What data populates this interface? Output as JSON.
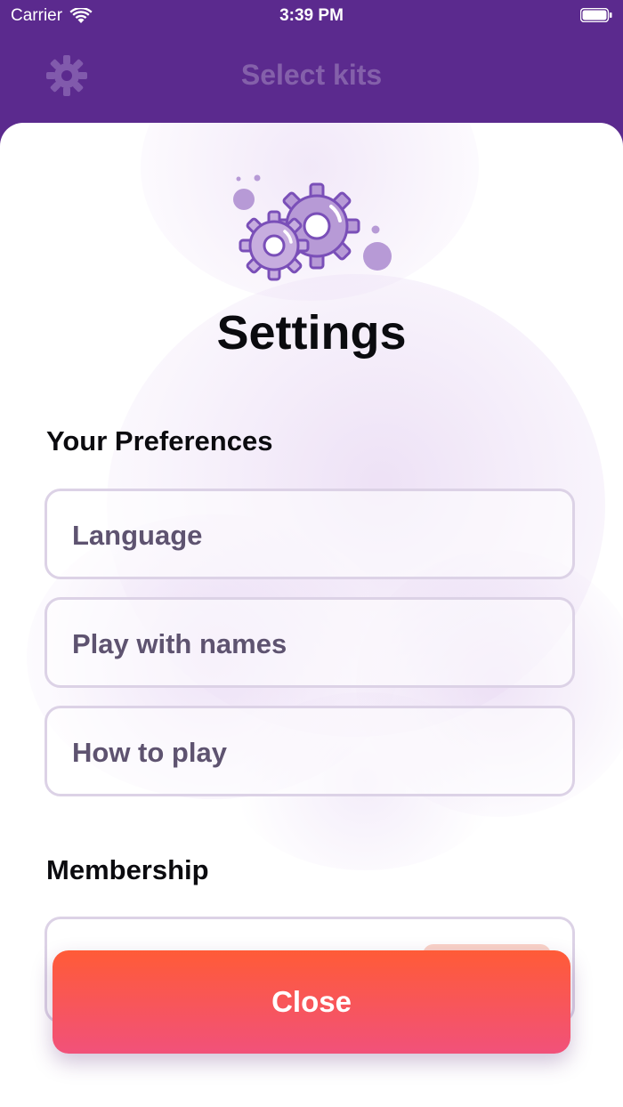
{
  "status_bar": {
    "carrier": "Carrier",
    "time": "3:39 PM"
  },
  "nav": {
    "title": "Select kits",
    "settings_icon": "gear-icon"
  },
  "sheet": {
    "icon": "gears-icon",
    "title": "Settings",
    "preferences": {
      "heading": "Your Preferences",
      "items": [
        {
          "label": "Language"
        },
        {
          "label": "Play with names"
        },
        {
          "label": "How to play"
        }
      ]
    },
    "membership": {
      "heading": "Membership"
    },
    "close_label": "Close"
  },
  "colors": {
    "nav_bg": "#5b2a8e",
    "accent_top": "#ff5b37",
    "accent_bottom": "#f1517a",
    "row_border": "#dcd2e6",
    "row_text": "#5e5370",
    "gear_fill": "#b79ad6",
    "gear_stroke": "#7a4fb8"
  }
}
